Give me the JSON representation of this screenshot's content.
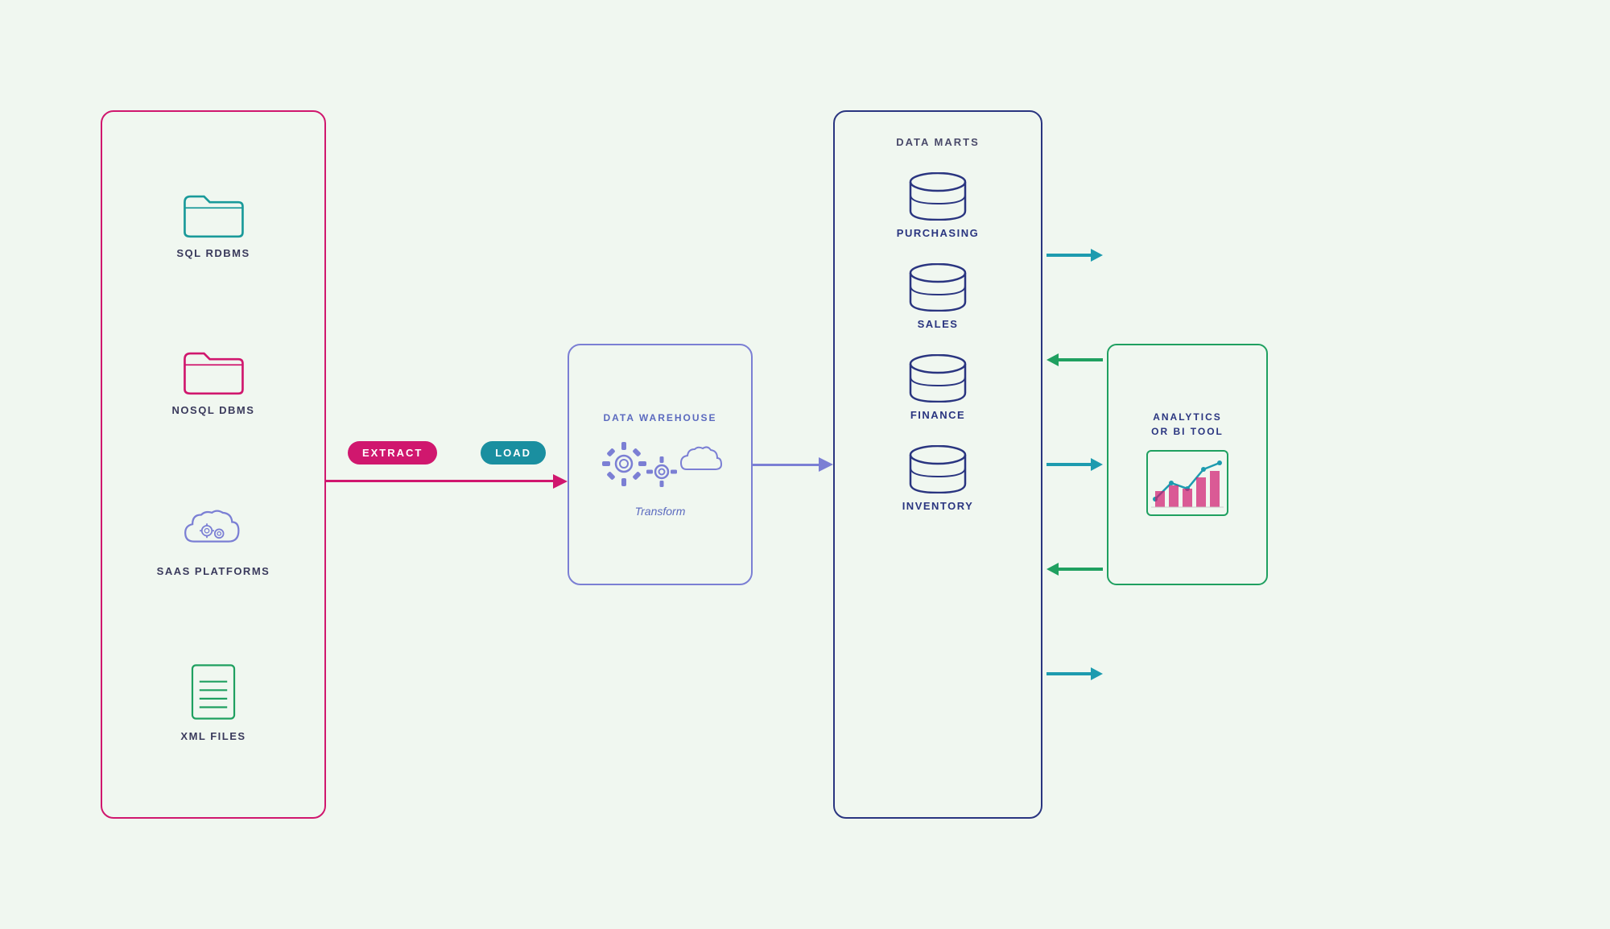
{
  "background_color": "#eef7ee",
  "source_box": {
    "border_color": "#d0176e",
    "items": [
      {
        "id": "sql-rdbms",
        "label": "SQL RDBMS",
        "type": "folder-teal"
      },
      {
        "id": "nosql-dbms",
        "label": "NOSQL DBMS",
        "type": "folder-pink"
      },
      {
        "id": "saas-platforms",
        "label": "SAAS PLATFORMS",
        "type": "cloud-purple"
      },
      {
        "id": "xml-files",
        "label": "XML FILES",
        "type": "document-green"
      }
    ]
  },
  "extract_badge": {
    "label": "EXTRACT",
    "color": "#d0176e"
  },
  "load_badge": {
    "label": "LOAD",
    "color": "#1a8fa0"
  },
  "data_warehouse": {
    "title": "DATA WAREHOUSE",
    "subtitle": "Transform",
    "border_color": "#7b7fd4"
  },
  "data_marts": {
    "title": "DATA MARTS",
    "border_color": "#2a3580",
    "items": [
      {
        "id": "purchasing",
        "label": "PURCHASING"
      },
      {
        "id": "sales",
        "label": "SALES"
      },
      {
        "id": "finance",
        "label": "FINANCE"
      },
      {
        "id": "inventory",
        "label": "INVENTORY"
      }
    ]
  },
  "analytics": {
    "title": "ANALYTICS\nOR BI TOOL",
    "border_color": "#1fa060"
  },
  "arrows": {
    "source_to_dw_color": "#d0176e",
    "dw_to_mart_color": "#7b7fd4",
    "mart_to_analytics_color": "#1d9baf",
    "analytics_to_mart_color": "#1fa060"
  }
}
